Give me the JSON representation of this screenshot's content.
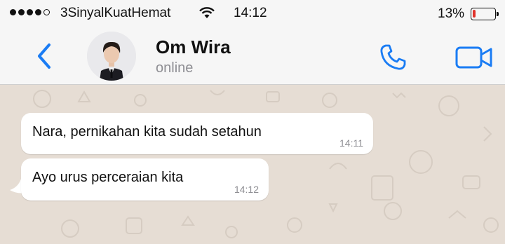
{
  "status_bar": {
    "carrier": "3SinyalKuatHemat",
    "time": "14:12",
    "battery_percent": "13%",
    "battery_level": 0.13,
    "signal_bars_filled": 4,
    "signal_bars_total": 5
  },
  "header": {
    "contact_name": "Om Wira",
    "status": "online",
    "accent_color": "#1a7cf4"
  },
  "messages": [
    {
      "text": "Nara, pernikahan kita sudah setahun",
      "time": "14:11",
      "direction": "incoming"
    },
    {
      "text": "Ayo urus perceraian kita",
      "time": "14:12",
      "direction": "incoming"
    }
  ],
  "colors": {
    "chat_background": "#e6ddd4",
    "bubble": "#ffffff",
    "battery_low": "#e0322b"
  },
  "icons": [
    "back-chevron-icon",
    "phone-icon",
    "video-camera-icon",
    "wifi-icon"
  ]
}
